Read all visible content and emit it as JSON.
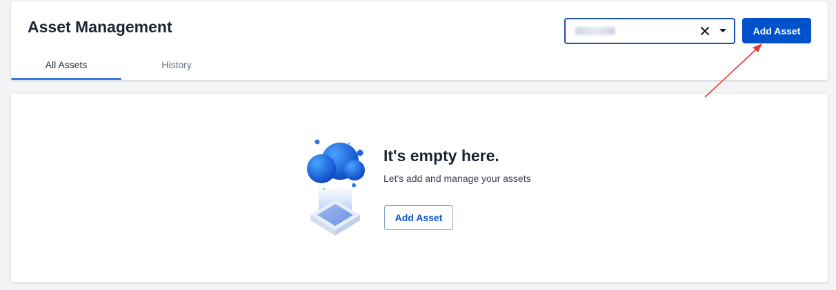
{
  "header": {
    "title": "Asset Management",
    "tabs": [
      {
        "label": "All Assets",
        "active": true
      },
      {
        "label": "History",
        "active": false
      }
    ],
    "search": {
      "value_redacted": true,
      "clear_icon": "close-icon",
      "dropdown_icon": "caret-down-icon"
    },
    "add_button_label": "Add Asset"
  },
  "empty_state": {
    "title": "It's empty here.",
    "subtitle": "Let's add and manage your assets",
    "button_label": "Add Asset",
    "illustration_icon": "cloud-illustration"
  },
  "annotation": {
    "type": "arrow",
    "color": "#e53935"
  },
  "colors": {
    "primary": "#0052cc",
    "tab_indicator": "#3a79e8",
    "select_border": "#1d4ea8",
    "background": "#f3f4f6"
  }
}
